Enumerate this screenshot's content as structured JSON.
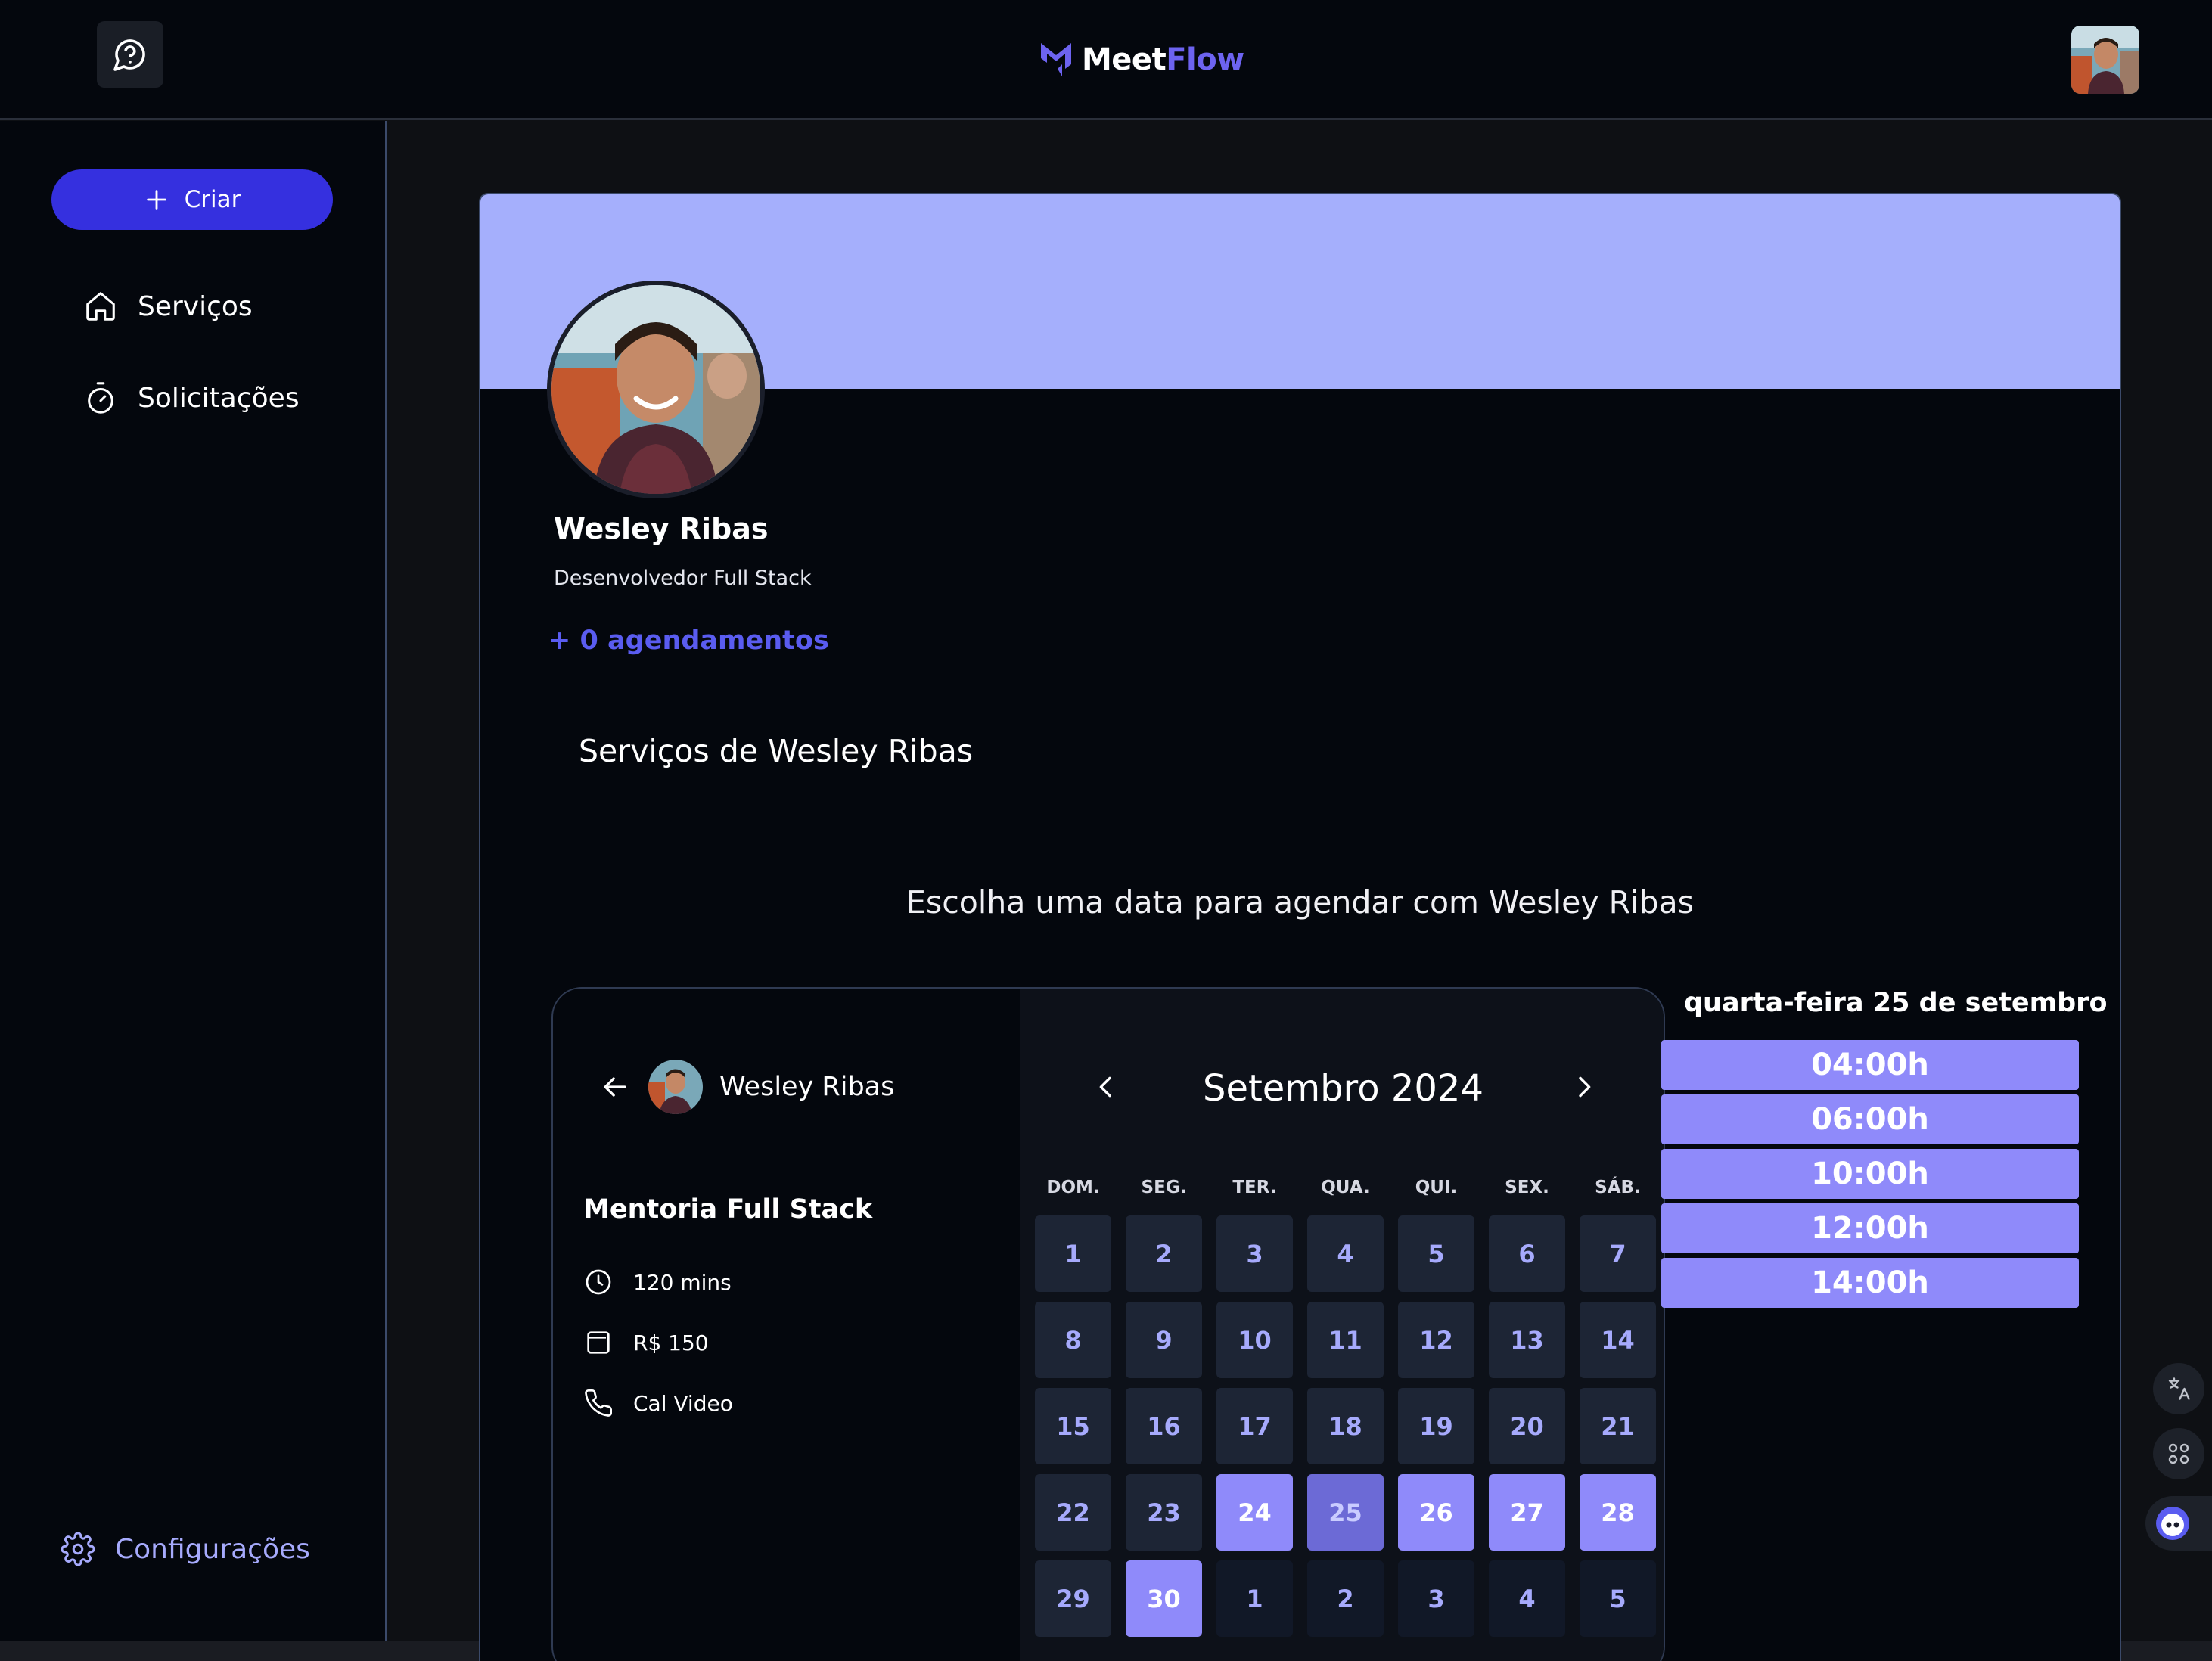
{
  "header": {
    "logo_part1": "Meet",
    "logo_part2": "Flow",
    "brand_color": "#6d63f0"
  },
  "sidebar": {
    "create_label": "Criar",
    "items": [
      {
        "label": "Serviços",
        "icon": "home-icon"
      },
      {
        "label": "Solicitações",
        "icon": "timer-icon"
      }
    ],
    "settings_label": "Configurações"
  },
  "profile": {
    "name": "Wesley Ribas",
    "role": "Desenvolvedor Full Stack",
    "appointments": "+ 0 agendamentos",
    "services_title": "Serviços de Wesley Ribas",
    "choose_date": "Escolha uma data para agendar com Wesley Ribas"
  },
  "booker": {
    "host_name": "Wesley Ribas",
    "event_title": "Mentoria Full Stack",
    "duration": "120 mins",
    "price": "R$ 150",
    "location": "Cal Video",
    "month_title": "Setembro 2024",
    "weekdays": [
      "DOM.",
      "SEG.",
      "TER.",
      "QUA.",
      "QUI.",
      "SEX.",
      "SÁB."
    ],
    "days": [
      {
        "n": "1",
        "state": "default"
      },
      {
        "n": "2",
        "state": "default"
      },
      {
        "n": "3",
        "state": "default"
      },
      {
        "n": "4",
        "state": "default"
      },
      {
        "n": "5",
        "state": "default"
      },
      {
        "n": "6",
        "state": "default"
      },
      {
        "n": "7",
        "state": "default"
      },
      {
        "n": "8",
        "state": "default"
      },
      {
        "n": "9",
        "state": "default"
      },
      {
        "n": "10",
        "state": "default"
      },
      {
        "n": "11",
        "state": "default"
      },
      {
        "n": "12",
        "state": "default"
      },
      {
        "n": "13",
        "state": "default"
      },
      {
        "n": "14",
        "state": "default"
      },
      {
        "n": "15",
        "state": "default"
      },
      {
        "n": "16",
        "state": "default"
      },
      {
        "n": "17",
        "state": "default"
      },
      {
        "n": "18",
        "state": "default"
      },
      {
        "n": "19",
        "state": "default"
      },
      {
        "n": "20",
        "state": "default"
      },
      {
        "n": "21",
        "state": "default"
      },
      {
        "n": "22",
        "state": "default"
      },
      {
        "n": "23",
        "state": "default"
      },
      {
        "n": "24",
        "state": "available"
      },
      {
        "n": "25",
        "state": "selected"
      },
      {
        "n": "26",
        "state": "available"
      },
      {
        "n": "27",
        "state": "available"
      },
      {
        "n": "28",
        "state": "available"
      },
      {
        "n": "29",
        "state": "default"
      },
      {
        "n": "30",
        "state": "available"
      },
      {
        "n": "1",
        "state": "outside"
      },
      {
        "n": "2",
        "state": "outside"
      },
      {
        "n": "3",
        "state": "outside"
      },
      {
        "n": "4",
        "state": "outside"
      },
      {
        "n": "5",
        "state": "outside"
      }
    ]
  },
  "slots": {
    "date_label": "quarta-feira 25 de setembro",
    "times": [
      "04:00h",
      "06:00h",
      "10:00h",
      "12:00h",
      "14:00h"
    ]
  },
  "colors": {
    "accent": "#3530df",
    "banner": "#a5affc",
    "slot": "#8f8afa",
    "background": "#04070d"
  }
}
